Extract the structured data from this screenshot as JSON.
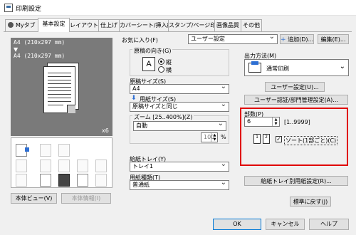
{
  "window": {
    "title": "印刷設定"
  },
  "tabs": [
    {
      "label": "Myタブ"
    },
    {
      "label": "基本設定"
    },
    {
      "label": "レイアウト"
    },
    {
      "label": "仕上げ"
    },
    {
      "label": "カバーシート/挿入紙"
    },
    {
      "label": "スタンプ/ページ印字"
    },
    {
      "label": "画像品質"
    },
    {
      "label": "その他"
    }
  ],
  "preview": {
    "paper_size_1": "A4 (210x297 mm)",
    "arrow": "▼",
    "paper_size_2": "A4 (210x297 mm)",
    "copies_mark": "x6"
  },
  "left_buttons": {
    "paper_view": "本体ビュー(V)",
    "device_info": "本体情報(I)"
  },
  "favorites": {
    "label": "お気に入り(F)",
    "value": "ユーザー設定",
    "add_button": "追加(D)...",
    "edit_button": "編集(E)..."
  },
  "orientation": {
    "label": "原稿の向き(G)",
    "icon_letter": "A",
    "portrait": "縦",
    "landscape": "横"
  },
  "original_size": {
    "label": "原稿サイズ(S)",
    "value": "A4"
  },
  "paper_size": {
    "label": "用紙サイズ(S)",
    "value": "原稿サイズと同じ"
  },
  "zoom": {
    "label": "ズーム [25..400%](Z)",
    "mode": "自動",
    "value": "100",
    "unit": "%"
  },
  "paper_tray": {
    "label": "給紙トレイ(Y)",
    "value": "トレイ1"
  },
  "paper_type": {
    "label": "用紙種類(T)",
    "value": "普通紙"
  },
  "output": {
    "label": "出力方法(M)",
    "value": "通常印刷",
    "user_settings_button": "ユーザー設定(U)...",
    "auth_button": "ユーザー認証/部門管理設定(A)..."
  },
  "copies": {
    "label": "部数(P)",
    "value": "6",
    "range": "[1..9999]",
    "collate_label": "ソート(1部ごと)(C)",
    "collate_checked": true
  },
  "tray_settings_button": "給紙トレイ別用紙設定(R)...",
  "restore_defaults_button": "標準に戻す(J)",
  "dialog_buttons": {
    "ok": "OK",
    "cancel": "キャンセル",
    "help": "ヘルプ"
  },
  "colors": {
    "highlight": "#e00000",
    "accent": "#2e6fd3",
    "preview_bg": "#7a7a7a"
  }
}
